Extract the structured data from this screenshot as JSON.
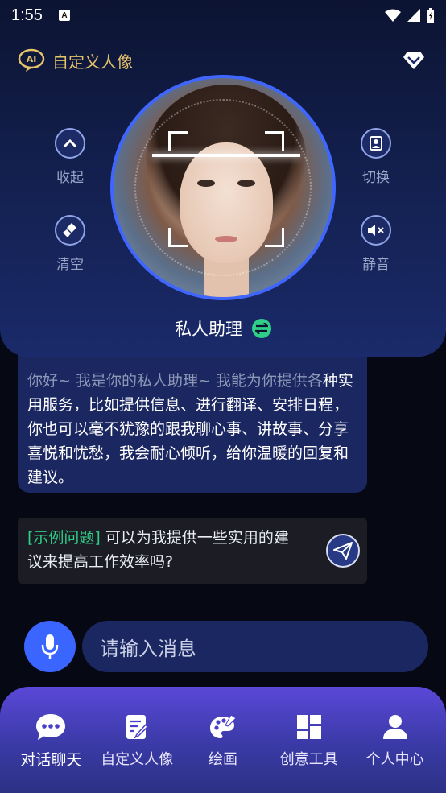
{
  "status_bar": {
    "time": "1:55"
  },
  "header": {
    "title": "自定义人像"
  },
  "side_buttons": {
    "collapse": "收起",
    "clear": "清空",
    "switch": "切换",
    "mute": "静音"
  },
  "assistant": {
    "name": "私人助理"
  },
  "chat": {
    "greeting_faded": "你好~ 我是你的私人助理~ 我能为你提供各",
    "greeting_rest": "种实用服务，比如提供信息、进行翻译、安排日程，你也可以毫不犹豫的跟我聊心事、讲故事、分享喜悦和忧愁，我会耐心倾听，给你温暖的回复和建议。"
  },
  "example": {
    "tag": "[示例问题]",
    "text": " 可以为我提供一些实用的建议来提高工作效率吗?"
  },
  "input": {
    "placeholder": "请输入消息"
  },
  "nav": {
    "items": [
      {
        "label": "对话聊天",
        "icon": "chat-icon",
        "active": true
      },
      {
        "label": "自定义人像",
        "icon": "edit-portrait-icon",
        "active": false
      },
      {
        "label": "绘画",
        "icon": "palette-icon",
        "active": false
      },
      {
        "label": "创意工具",
        "icon": "tools-grid-icon",
        "active": false
      },
      {
        "label": "个人中心",
        "icon": "person-icon",
        "active": false
      }
    ]
  },
  "colors": {
    "accent_blue": "#3a66ff",
    "gold": "#e7c36a",
    "green": "#2fcf88",
    "nav_purple": "#5a48d8"
  }
}
